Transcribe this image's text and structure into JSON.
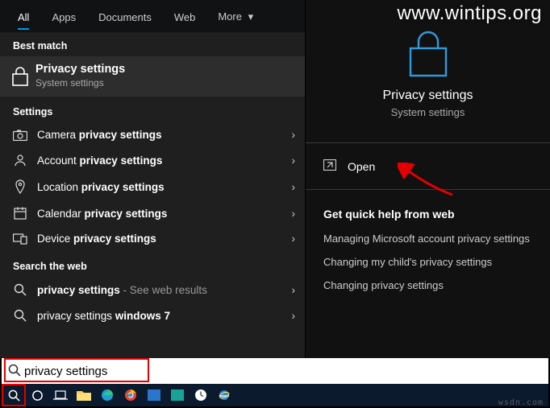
{
  "watermark": "www.wintips.org",
  "bottom_mark": "wsdn.com",
  "tabs": {
    "all": "All",
    "apps": "Apps",
    "documents": "Documents",
    "web": "Web",
    "more": "More"
  },
  "labels": {
    "best_match": "Best match",
    "settings": "Settings",
    "search_web": "Search the web"
  },
  "best_match": {
    "title": "Privacy settings",
    "subtitle": "System settings"
  },
  "settings_results": [
    {
      "pre": "Camera ",
      "bold": "privacy settings"
    },
    {
      "pre": "Account ",
      "bold": "privacy settings"
    },
    {
      "pre": "Location ",
      "bold": "privacy settings"
    },
    {
      "pre": "Calendar ",
      "bold": "privacy settings"
    },
    {
      "pre": "Device ",
      "bold": "privacy settings"
    }
  ],
  "web_results": [
    {
      "bold": "privacy settings",
      "suffix": " - See web results"
    },
    {
      "bold_pre": "privacy settings ",
      "bold": "windows 7",
      "suffix": ""
    }
  ],
  "detail": {
    "title": "Privacy settings",
    "subtitle": "System settings",
    "open_label": "Open",
    "quick_title": "Get quick help from web",
    "quick_links": [
      "Managing Microsoft account privacy settings",
      "Changing my child's privacy settings",
      "Changing privacy settings"
    ]
  },
  "search": {
    "value": "privacy settings"
  }
}
